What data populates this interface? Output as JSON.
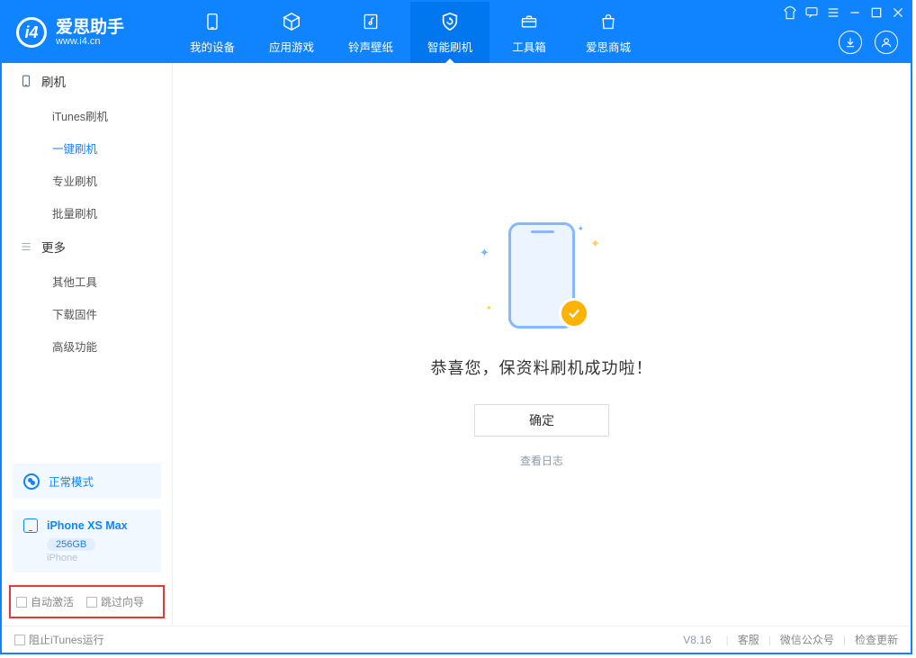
{
  "brand": {
    "zh": "爱思助手",
    "en": "www.i4.cn"
  },
  "nav": {
    "device": "我的设备",
    "apps": "应用游戏",
    "ring": "铃声壁纸",
    "flash": "智能刷机",
    "toolbox": "工具箱",
    "store": "爱思商城"
  },
  "sidebar": {
    "group_flash": "刷机",
    "items_flash": {
      "itunes": "iTunes刷机",
      "onekey": "一键刷机",
      "pro": "专业刷机",
      "batch": "批量刷机"
    },
    "group_more": "更多",
    "items_more": {
      "other": "其他工具",
      "download": "下载固件",
      "adv": "高级功能"
    }
  },
  "mode": {
    "label": "正常模式"
  },
  "device": {
    "name": "iPhone XS Max",
    "capacity": "256GB",
    "type": "iPhone"
  },
  "checks": {
    "auto_activate": "自动激活",
    "skip_guide": "跳过向导"
  },
  "main": {
    "message": "恭喜您，保资料刷机成功啦！",
    "ok": "确定",
    "viewlog": "查看日志"
  },
  "footer": {
    "block_itunes": "阻止iTunes运行",
    "version": "V8.16",
    "support": "客服",
    "wechat": "微信公众号",
    "update": "检查更新"
  }
}
